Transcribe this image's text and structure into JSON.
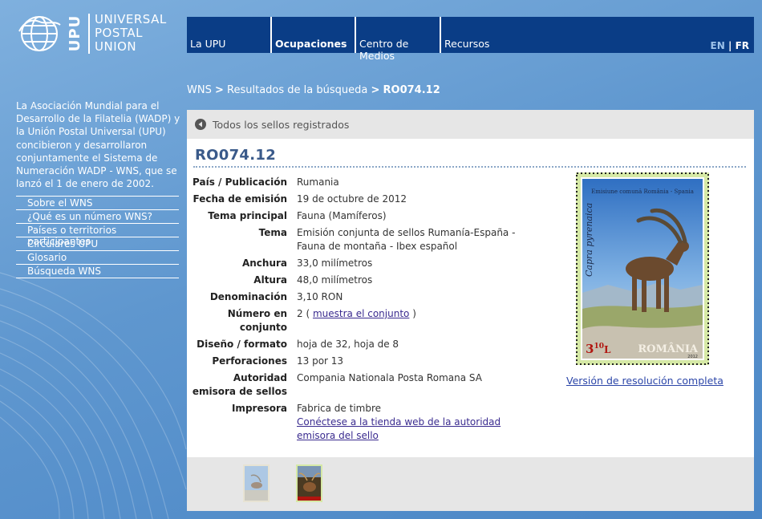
{
  "logo": {
    "abbr": "UPU",
    "words": [
      "UNIVERSAL",
      "POSTAL",
      "UNION"
    ]
  },
  "nav": {
    "items": [
      "La UPU",
      "Ocupaciones",
      "Centro de Medios",
      "Recursos"
    ],
    "lang_en": "EN",
    "lang_sep": "|",
    "lang_fr": "FR"
  },
  "sidebar": {
    "intro": "La Asociación Mundial para el Desarrollo de la Filatelia (WADP) y la Unión Postal Universal (UPU) concibieron y desarrollaron conjuntamente el Sistema de Numeración WADP - WNS, que se lanzó el 1 de enero de 2002.",
    "items": [
      "Sobre el WNS",
      "¿Qué es un número WNS?",
      "Países o territorios participantes",
      "Circulares UPU",
      "Glosario",
      "Búsqueda WNS"
    ]
  },
  "breadcrumb": {
    "root": "WNS",
    "sep": ">",
    "mid": "Resultados de la búsqueda",
    "current": "RO074.12"
  },
  "panel": {
    "back_label": "Todos los sellos registrados",
    "title": "RO074.12",
    "details": {
      "pais_k": "País / Publicación",
      "pais_v": "Rumania",
      "fecha_k": "Fecha de emisión",
      "fecha_v": "19 de octubre de 2012",
      "tema_principal_k": "Tema principal",
      "tema_principal_v": "Fauna (Mamíferos)",
      "tema_k": "Tema",
      "tema_v": "Emisión conjunta de sellos Rumanía-España - Fauna de montaña - Ibex español",
      "anchura_k": "Anchura",
      "anchura_v": "33,0 milímetros",
      "altura_k": "Altura",
      "altura_v": "48,0 milímetros",
      "denominacion_k": "Denominación",
      "denominacion_v": "3,10 RON",
      "numero_k": "Número en conjunto",
      "numero_prefix": "2 (",
      "numero_link": "muestra el conjunto",
      "numero_suffix": ")",
      "diseno_k": "Diseño / formato",
      "diseno_v": "hoja de 32, hoja de 8",
      "perforaciones_k": "Perforaciones",
      "perforaciones_v": "13 por 13",
      "autoridad_k": "Autoridad emisora de sellos",
      "autoridad_v": "Compania Nationala Posta Romana SA",
      "impresora_k": "Impresora",
      "impresora_v": "Fabrica de timbre",
      "tienda_link": "Conéctese a la tienda web de la autoridad emisora del sello"
    },
    "stamp": {
      "header": "Emisiune comună România - Spania",
      "species": "Capra pyrenaica",
      "value_main": "3",
      "value_sup": "10",
      "value_unit": "L",
      "country": "ROMÂNIA",
      "year": "2012"
    },
    "fullres_link": "Versión de resolución completa"
  }
}
